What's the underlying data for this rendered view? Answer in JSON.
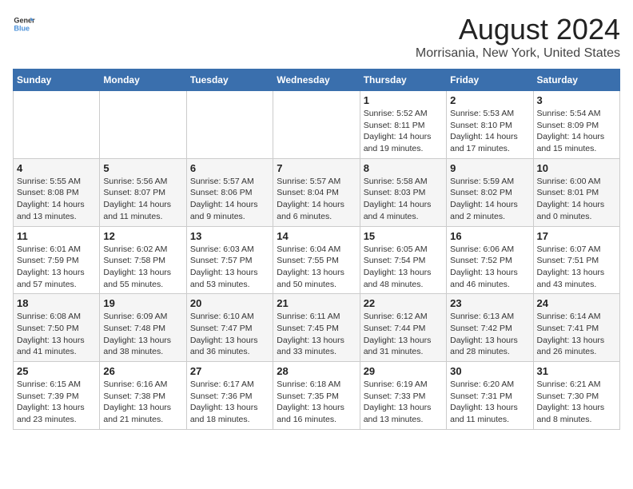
{
  "header": {
    "logo_line1": "General",
    "logo_line2": "Blue",
    "main_title": "August 2024",
    "subtitle": "Morrisania, New York, United States"
  },
  "days_of_week": [
    "Sunday",
    "Monday",
    "Tuesday",
    "Wednesday",
    "Thursday",
    "Friday",
    "Saturday"
  ],
  "weeks": [
    [
      {
        "day": "",
        "info": ""
      },
      {
        "day": "",
        "info": ""
      },
      {
        "day": "",
        "info": ""
      },
      {
        "day": "",
        "info": ""
      },
      {
        "day": "1",
        "info": "Sunrise: 5:52 AM\nSunset: 8:11 PM\nDaylight: 14 hours\nand 19 minutes."
      },
      {
        "day": "2",
        "info": "Sunrise: 5:53 AM\nSunset: 8:10 PM\nDaylight: 14 hours\nand 17 minutes."
      },
      {
        "day": "3",
        "info": "Sunrise: 5:54 AM\nSunset: 8:09 PM\nDaylight: 14 hours\nand 15 minutes."
      }
    ],
    [
      {
        "day": "4",
        "info": "Sunrise: 5:55 AM\nSunset: 8:08 PM\nDaylight: 14 hours\nand 13 minutes."
      },
      {
        "day": "5",
        "info": "Sunrise: 5:56 AM\nSunset: 8:07 PM\nDaylight: 14 hours\nand 11 minutes."
      },
      {
        "day": "6",
        "info": "Sunrise: 5:57 AM\nSunset: 8:06 PM\nDaylight: 14 hours\nand 9 minutes."
      },
      {
        "day": "7",
        "info": "Sunrise: 5:57 AM\nSunset: 8:04 PM\nDaylight: 14 hours\nand 6 minutes."
      },
      {
        "day": "8",
        "info": "Sunrise: 5:58 AM\nSunset: 8:03 PM\nDaylight: 14 hours\nand 4 minutes."
      },
      {
        "day": "9",
        "info": "Sunrise: 5:59 AM\nSunset: 8:02 PM\nDaylight: 14 hours\nand 2 minutes."
      },
      {
        "day": "10",
        "info": "Sunrise: 6:00 AM\nSunset: 8:01 PM\nDaylight: 14 hours\nand 0 minutes."
      }
    ],
    [
      {
        "day": "11",
        "info": "Sunrise: 6:01 AM\nSunset: 7:59 PM\nDaylight: 13 hours\nand 57 minutes."
      },
      {
        "day": "12",
        "info": "Sunrise: 6:02 AM\nSunset: 7:58 PM\nDaylight: 13 hours\nand 55 minutes."
      },
      {
        "day": "13",
        "info": "Sunrise: 6:03 AM\nSunset: 7:57 PM\nDaylight: 13 hours\nand 53 minutes."
      },
      {
        "day": "14",
        "info": "Sunrise: 6:04 AM\nSunset: 7:55 PM\nDaylight: 13 hours\nand 50 minutes."
      },
      {
        "day": "15",
        "info": "Sunrise: 6:05 AM\nSunset: 7:54 PM\nDaylight: 13 hours\nand 48 minutes."
      },
      {
        "day": "16",
        "info": "Sunrise: 6:06 AM\nSunset: 7:52 PM\nDaylight: 13 hours\nand 46 minutes."
      },
      {
        "day": "17",
        "info": "Sunrise: 6:07 AM\nSunset: 7:51 PM\nDaylight: 13 hours\nand 43 minutes."
      }
    ],
    [
      {
        "day": "18",
        "info": "Sunrise: 6:08 AM\nSunset: 7:50 PM\nDaylight: 13 hours\nand 41 minutes."
      },
      {
        "day": "19",
        "info": "Sunrise: 6:09 AM\nSunset: 7:48 PM\nDaylight: 13 hours\nand 38 minutes."
      },
      {
        "day": "20",
        "info": "Sunrise: 6:10 AM\nSunset: 7:47 PM\nDaylight: 13 hours\nand 36 minutes."
      },
      {
        "day": "21",
        "info": "Sunrise: 6:11 AM\nSunset: 7:45 PM\nDaylight: 13 hours\nand 33 minutes."
      },
      {
        "day": "22",
        "info": "Sunrise: 6:12 AM\nSunset: 7:44 PM\nDaylight: 13 hours\nand 31 minutes."
      },
      {
        "day": "23",
        "info": "Sunrise: 6:13 AM\nSunset: 7:42 PM\nDaylight: 13 hours\nand 28 minutes."
      },
      {
        "day": "24",
        "info": "Sunrise: 6:14 AM\nSunset: 7:41 PM\nDaylight: 13 hours\nand 26 minutes."
      }
    ],
    [
      {
        "day": "25",
        "info": "Sunrise: 6:15 AM\nSunset: 7:39 PM\nDaylight: 13 hours\nand 23 minutes."
      },
      {
        "day": "26",
        "info": "Sunrise: 6:16 AM\nSunset: 7:38 PM\nDaylight: 13 hours\nand 21 minutes."
      },
      {
        "day": "27",
        "info": "Sunrise: 6:17 AM\nSunset: 7:36 PM\nDaylight: 13 hours\nand 18 minutes."
      },
      {
        "day": "28",
        "info": "Sunrise: 6:18 AM\nSunset: 7:35 PM\nDaylight: 13 hours\nand 16 minutes."
      },
      {
        "day": "29",
        "info": "Sunrise: 6:19 AM\nSunset: 7:33 PM\nDaylight: 13 hours\nand 13 minutes."
      },
      {
        "day": "30",
        "info": "Sunrise: 6:20 AM\nSunset: 7:31 PM\nDaylight: 13 hours\nand 11 minutes."
      },
      {
        "day": "31",
        "info": "Sunrise: 6:21 AM\nSunset: 7:30 PM\nDaylight: 13 hours\nand 8 minutes."
      }
    ]
  ]
}
